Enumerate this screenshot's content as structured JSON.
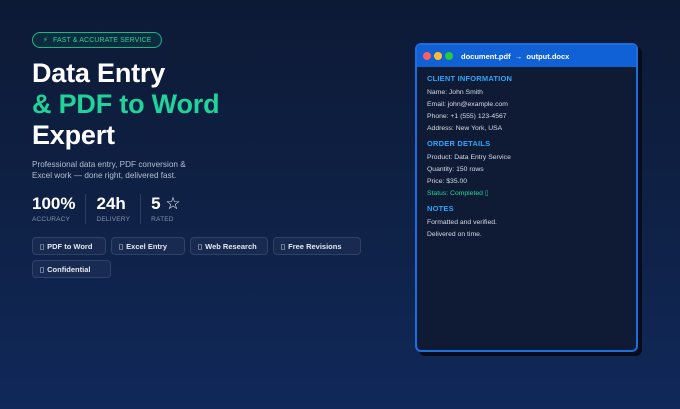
{
  "badge": {
    "icon": "bolt-icon",
    "text": "FAST & ACCURATE SERVICE"
  },
  "headline": {
    "line1": "Data Entry",
    "line2": "& PDF to Word",
    "line3": "Expert"
  },
  "description": "Professional data entry, PDF conversion & Excel work — done right, delivered fast.",
  "stats": [
    {
      "value": "100%",
      "label": "ACCURACY"
    },
    {
      "value": "24h",
      "label": "DELIVERY"
    },
    {
      "value": "5 ",
      "icon": "star-icon",
      "label": "RATED"
    }
  ],
  "tags": [
    {
      "icon": "document-icon",
      "label": "PDF to Word"
    },
    {
      "icon": "spreadsheet-icon",
      "label": "Excel Entry"
    },
    {
      "icon": "search-icon",
      "label": "Web Research"
    },
    {
      "icon": "refresh-icon",
      "label": "Free Revisions"
    },
    {
      "icon": "lock-icon",
      "label": "Confidential"
    }
  ],
  "window": {
    "title": "document.pdf  →  output.docx",
    "sections": [
      {
        "title": "CLIENT INFORMATION",
        "lines": [
          "Name:  John Smith",
          "Email:  john@example.com",
          "Phone: +1 (555) 123-4567",
          "Address: New York, USA"
        ]
      },
      {
        "title": "ORDER DETAILS",
        "lines": [
          "Product: Data Entry Service",
          "Quantity: 150 rows",
          "Price: $35.00"
        ],
        "status": "Status: Completed"
      },
      {
        "title": "NOTES",
        "lines": [
          "Formatted and verified.",
          "Delivered on time."
        ]
      }
    ]
  },
  "colors": {
    "accent": "#1fd49a",
    "window_bar": "#1060d6",
    "section_title": "#2aa6ff"
  }
}
